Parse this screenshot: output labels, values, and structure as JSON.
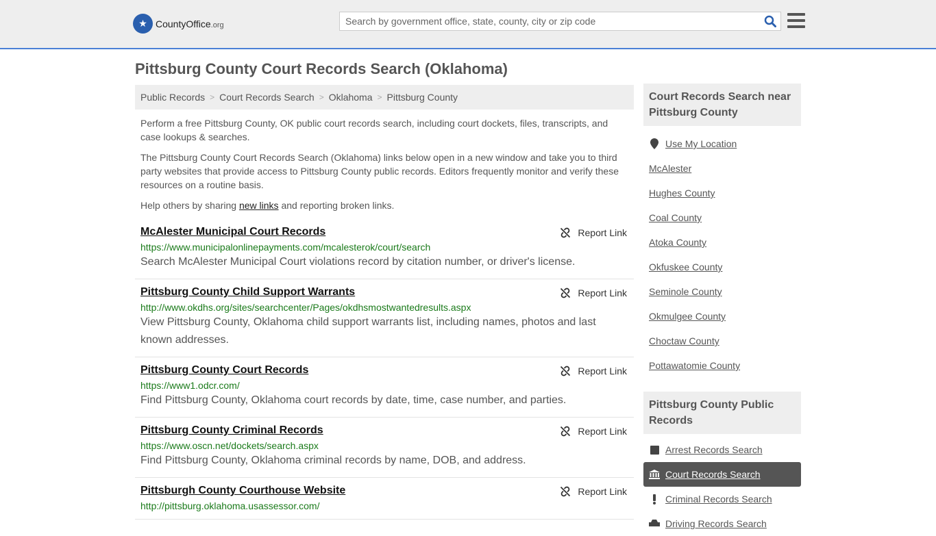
{
  "header": {
    "logo_main": "CountyOffice",
    "logo_suffix": ".org",
    "search_placeholder": "Search by government office, state, county, city or zip code"
  },
  "page": {
    "title": "Pittsburg County Court Records Search (Oklahoma)"
  },
  "breadcrumb": [
    "Public Records",
    "Court Records Search",
    "Oklahoma",
    "Pittsburg County"
  ],
  "intro": {
    "p1": "Perform a free Pittsburg County, OK public court records search, including court dockets, files, transcripts, and case lookups & searches.",
    "p2": "The Pittsburg County Court Records Search (Oklahoma) links below open in a new window and take you to third party websites that provide access to Pittsburg County public records. Editors frequently monitor and verify these resources on a routine basis.",
    "p3_before": "Help others by sharing ",
    "p3_link": "new links",
    "p3_after": " and reporting broken links."
  },
  "report_label": "Report Link",
  "results": [
    {
      "title": "McAlester Municipal Court Records",
      "url": "https://www.municipalonlinepayments.com/mcalesterok/court/search",
      "desc": "Search McAlester Municipal Court violations record by citation number, or driver's license."
    },
    {
      "title": "Pittsburg County Child Support Warrants",
      "url": "http://www.okdhs.org/sites/searchcenter/Pages/okdhsmostwantedresults.aspx",
      "desc": "View Pittsburg County, Oklahoma child support warrants list, including names, photos and last known addresses."
    },
    {
      "title": "Pittsburg County Court Records",
      "url": "https://www1.odcr.com/",
      "desc": "Find Pittsburg County, Oklahoma court records by date, time, case number, and parties."
    },
    {
      "title": "Pittsburg County Criminal Records",
      "url": "https://www.oscn.net/dockets/search.aspx",
      "desc": "Find Pittsburg County, Oklahoma criminal records by name, DOB, and address."
    },
    {
      "title": "Pittsburgh County Courthouse Website",
      "url": "http://pittsburg.oklahoma.usassessor.com/",
      "desc": ""
    }
  ],
  "sidebar": {
    "near_heading": "Court Records Search near Pittsburg County",
    "near_items": [
      "Use My Location",
      "McAlester",
      "Hughes County",
      "Coal County",
      "Atoka County",
      "Okfuskee County",
      "Seminole County",
      "Okmulgee County",
      "Choctaw County",
      "Pottawatomie County"
    ],
    "public_heading": "Pittsburg County Public Records",
    "public_items": [
      {
        "label": "Arrest Records Search",
        "icon": "square-icon"
      },
      {
        "label": "Court Records Search",
        "icon": "courthouse-icon",
        "active": true
      },
      {
        "label": "Criminal Records Search",
        "icon": "exclamation-icon"
      },
      {
        "label": "Driving Records Search",
        "icon": "car-icon"
      }
    ]
  }
}
